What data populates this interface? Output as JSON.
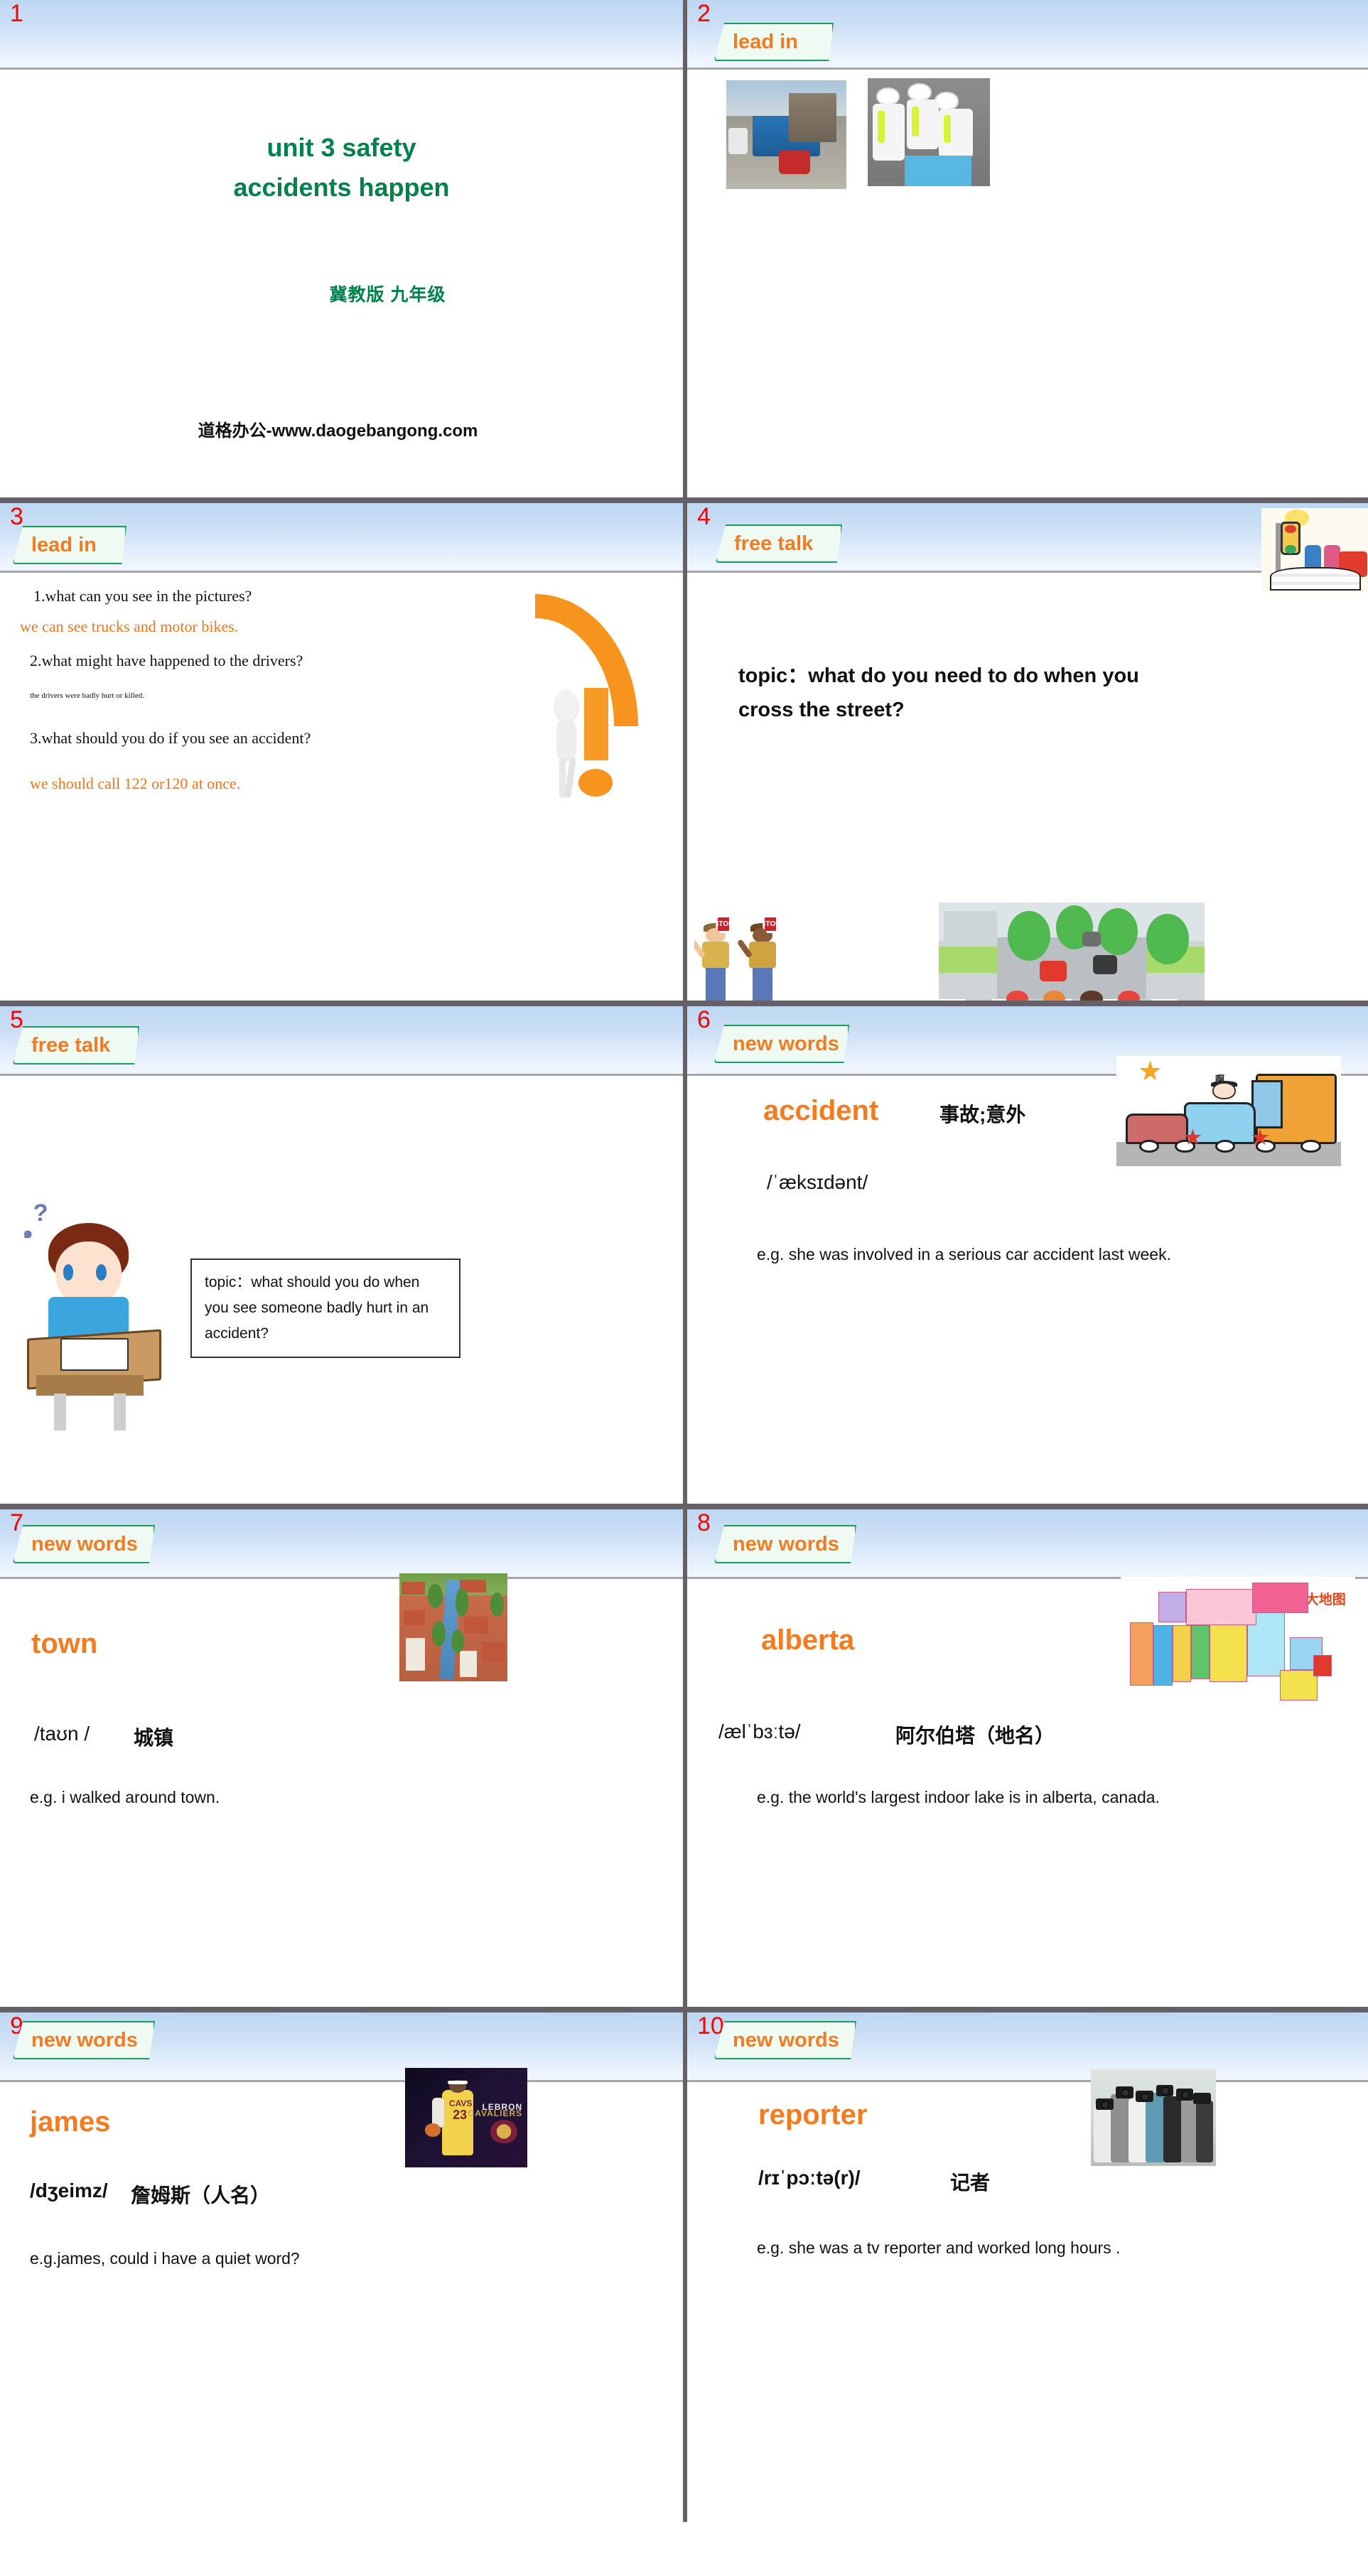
{
  "deck": {
    "watermark": "道格办公-www.daogebangong.com",
    "accent_orange": "#f47b20",
    "accent_green": "#00824a",
    "slide_number_color": "#ff0000"
  },
  "slides": [
    {
      "number": "1",
      "title_line1": "unit 3 safety",
      "title_line2": "accidents happen",
      "subtitle": "冀教版    九年级",
      "watermark": "道格办公-www.daogebangong.com"
    },
    {
      "number": "2",
      "tab": "lead in",
      "images": [
        "truck-motorbike-accident-photo",
        "medics-120-rescue-photo"
      ]
    },
    {
      "number": "3",
      "tab": "lead in",
      "q1": "1.what can you see in the pictures?",
      "a1": "we can see trucks and motor bikes.",
      "q2": "2.what might have happened to the drivers?",
      "a2": "the drivers were badly hurt or killed.",
      "q3": "3.what should you do if you see an accident?",
      "a3": "we should call 122 or120 at once.",
      "image": "orange-question-mark-3d-figure"
    },
    {
      "number": "4",
      "tab": "free talk",
      "topic": "topic：what do you need to do when you cross the street?",
      "images": [
        "traffic-light-clipart",
        "kids-crossing-street-clipart",
        "stop-sign-guards-clipart"
      ]
    },
    {
      "number": "5",
      "tab": "free talk",
      "topic": "topic：what should you do when you see someone badly hurt in an accident?",
      "image": "thinking-boy-at-desk-clipart"
    },
    {
      "number": "6",
      "tab": "new words",
      "word": "accident",
      "chinese": "事故;意外",
      "ipa": "/ˈæksɪdənt/",
      "example": "e.g. she was involved in a serious car accident last week.",
      "image": "car-crash-cartoon"
    },
    {
      "number": "7",
      "tab": "new words",
      "word": "town",
      "chinese": "城镇",
      "ipa": "/taʊn /",
      "example": "e.g. i walked around town.",
      "image": "dutch-canal-town-photo"
    },
    {
      "number": "8",
      "tab": "new words",
      "word": "alberta",
      "chinese": "阿尔伯塔（地名）",
      "ipa": "/ælˈbɜːtə/",
      "example": "e.g. the world's largest indoor lake is in alberta, canada.",
      "image": "canada-map",
      "image_caption": "加拿大地图"
    },
    {
      "number": "9",
      "tab": "new words",
      "word": "james",
      "chinese": "詹姆斯（人名）",
      "ipa": "/dʒeimz/",
      "example": "e.g.james, could i have a quiet word?",
      "image": "lebron-james-cavaliers-photo",
      "image_text1": "LEBRON",
      "image_text2": "CAVALIERS",
      "jersey_number": "23",
      "jersey_team": "CAVS"
    },
    {
      "number": "10",
      "tab": "new words",
      "word": "reporter",
      "chinese": "记者",
      "ipa": "/rɪˈpɔːtə(r)/",
      "example": "e.g. she was a tv reporter and worked long hours .",
      "image": "press-photographers-photo"
    }
  ]
}
